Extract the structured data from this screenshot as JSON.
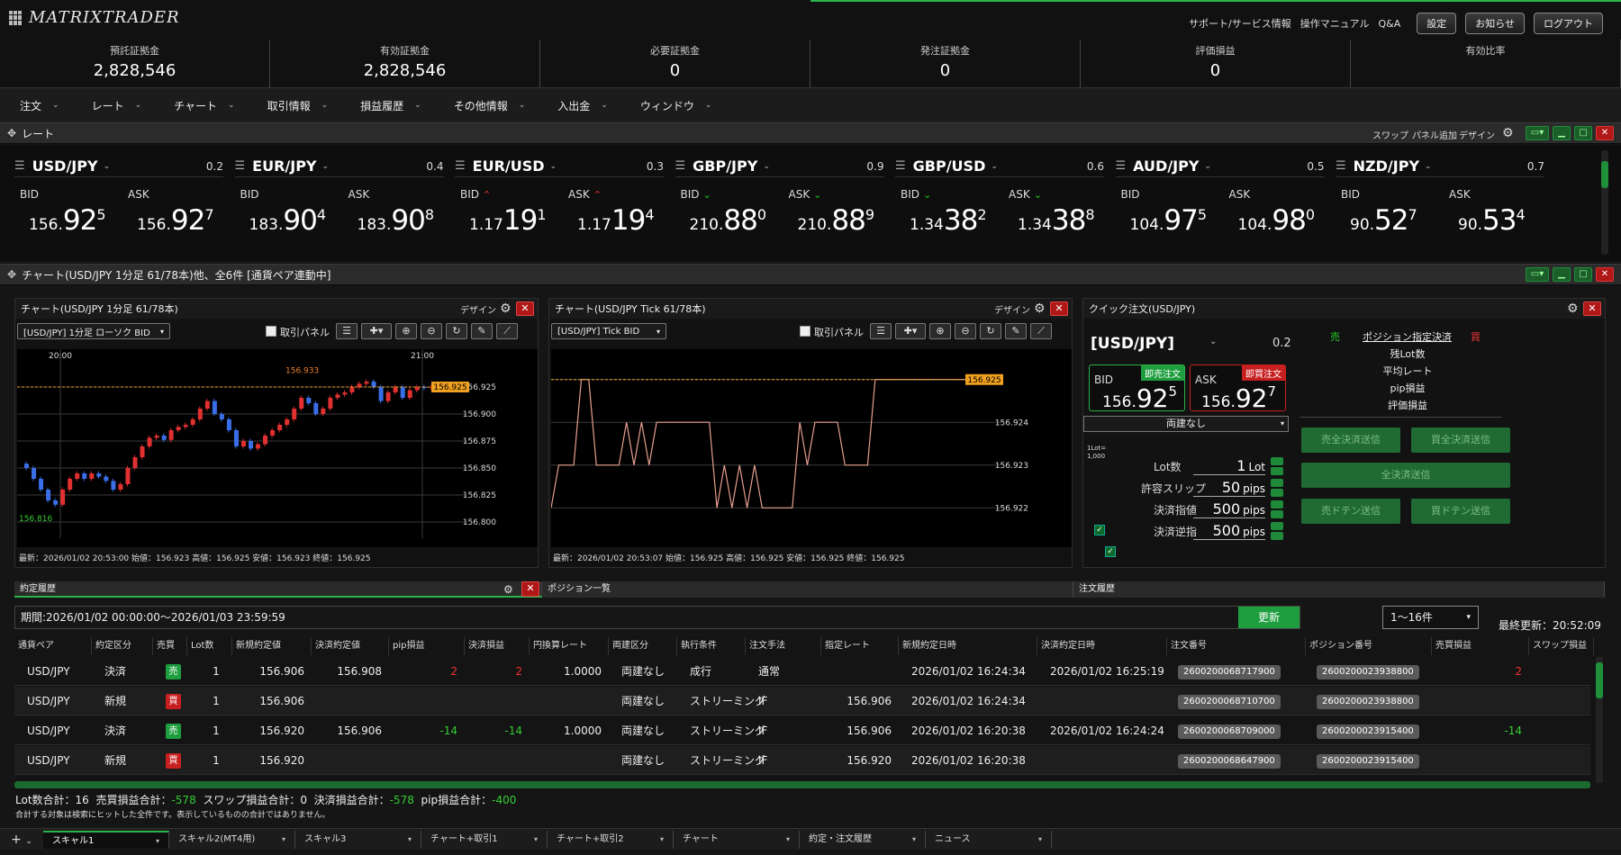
{
  "app": {
    "logo": "MATRIXTRADER"
  },
  "top_links": [
    "サポート/サービス情報",
    "操作マニュアル",
    "Q&A"
  ],
  "top_buttons": [
    "設定",
    "お知らせ",
    "ログアウト"
  ],
  "account": [
    {
      "label": "預託証拠金",
      "value": "2,828,546"
    },
    {
      "label": "有効証拠金",
      "value": "2,828,546"
    },
    {
      "label": "必要証拠金",
      "value": "0"
    },
    {
      "label": "発注証拠金",
      "value": "0"
    },
    {
      "label": "評価損益",
      "value": "0"
    },
    {
      "label": "有効比率",
      "value": ""
    }
  ],
  "menu": [
    "注文",
    "レート",
    "チャート",
    "取引情報",
    "損益履歴",
    "その他情報",
    "入出金",
    "ウィンドウ"
  ],
  "rate_panel": {
    "title": "レート",
    "actions": [
      "スワップ",
      "パネル追加",
      "デザイン"
    ]
  },
  "rates": [
    {
      "symbol": "USD/JPY",
      "spread": "0.2",
      "bid": {
        "s": "156.",
        "b": "92",
        "t": "5"
      },
      "ask": {
        "s": "156.",
        "b": "92",
        "t": "7"
      },
      "bid_dir": "",
      "ask_dir": ""
    },
    {
      "symbol": "EUR/JPY",
      "spread": "0.4",
      "bid": {
        "s": "183.",
        "b": "90",
        "t": "4"
      },
      "ask": {
        "s": "183.",
        "b": "90",
        "t": "8"
      },
      "bid_dir": "",
      "ask_dir": ""
    },
    {
      "symbol": "EUR/USD",
      "spread": "0.3",
      "bid": {
        "s": "1.17",
        "b": "19",
        "t": "1"
      },
      "ask": {
        "s": "1.17",
        "b": "19",
        "t": "4"
      },
      "bid_dir": "up",
      "ask_dir": "up"
    },
    {
      "symbol": "GBP/JPY",
      "spread": "0.9",
      "bid": {
        "s": "210.",
        "b": "88",
        "t": "0"
      },
      "ask": {
        "s": "210.",
        "b": "88",
        "t": "9"
      },
      "bid_dir": "down",
      "ask_dir": "down"
    },
    {
      "symbol": "GBP/USD",
      "spread": "0.6",
      "bid": {
        "s": "1.34",
        "b": "38",
        "t": "2"
      },
      "ask": {
        "s": "1.34",
        "b": "38",
        "t": "8"
      },
      "bid_dir": "down",
      "ask_dir": "down"
    },
    {
      "symbol": "AUD/JPY",
      "spread": "0.5",
      "bid": {
        "s": "104.",
        "b": "97",
        "t": "5"
      },
      "ask": {
        "s": "104.",
        "b": "98",
        "t": "0"
      },
      "bid_dir": "",
      "ask_dir": ""
    },
    {
      "symbol": "NZD/JPY",
      "spread": "0.7",
      "bid": {
        "s": "90.",
        "b": "52",
        "t": "7"
      },
      "ask": {
        "s": "90.",
        "b": "53",
        "t": "4"
      },
      "bid_dir": "",
      "ask_dir": ""
    }
  ],
  "labels": {
    "bid": "BID",
    "ask": "ASK",
    "design": "デザイン",
    "torihiki_panel": "取引パネル"
  },
  "chart_panel_title": "チャート(USD/JPY 1分足 61/78本)他、全6件 [通貨ペア連動中]",
  "chart1": {
    "title": "チャート(USD/JPY 1分足 61/78本)",
    "selector": "[USD/JPY] 1分足 ローソク BID",
    "time_labels": [
      "20:00",
      "21:00"
    ],
    "footer": "最新：2026/01/02 20:53:00  始値：156.923  高値：156.925  安値：156.923  終値：156.925"
  },
  "chart2": {
    "title": "チャート(USD/JPY Tick 61/78本)",
    "selector": "[USD/JPY] Tick BID",
    "footer": "最新：2026/01/02 20:53:07  始値：156.925  高値：156.925  安値：156.925  終値：156.925"
  },
  "chart_data": [
    {
      "type": "candlestick",
      "title": "チャート(USD/JPY 1分足 61/78本)",
      "x_ticks": [
        "20:00",
        "21:00"
      ],
      "y_ticks": [
        156.8,
        156.825,
        156.85,
        156.875,
        156.9,
        156.925
      ],
      "ylim": [
        156.795,
        156.945
      ],
      "current": 156.925,
      "high_label": 156.933,
      "low_label": 156.816,
      "closes": [
        156.85,
        156.84,
        156.83,
        156.82,
        156.816,
        156.83,
        156.84,
        156.845,
        156.84,
        156.845,
        156.842,
        156.838,
        156.83,
        156.835,
        156.85,
        156.86,
        156.87,
        156.878,
        156.88,
        156.876,
        156.885,
        156.888,
        156.89,
        156.895,
        156.905,
        156.912,
        156.9,
        156.895,
        156.885,
        156.87,
        156.875,
        156.868,
        156.872,
        156.88,
        156.885,
        156.89,
        156.895,
        156.905,
        156.915,
        156.91,
        156.9,
        156.905,
        156.915,
        156.918,
        156.92,
        156.925,
        156.928,
        156.93,
        156.925,
        156.912,
        156.92,
        156.925,
        156.915,
        156.922,
        156.925,
        156.924,
        156.925,
        156.923,
        156.925,
        156.925,
        156.925
      ],
      "grid": true
    },
    {
      "type": "line",
      "title": "チャート(USD/JPY Tick 61/78本)",
      "y_ticks": [
        156.922,
        156.923,
        156.924,
        156.925
      ],
      "ylim": [
        156.9215,
        156.9255
      ],
      "current": 156.925,
      "values": [
        156.922,
        156.923,
        156.923,
        156.923,
        156.925,
        156.925,
        156.923,
        156.923,
        156.923,
        156.923,
        156.924,
        156.923,
        156.924,
        156.923,
        156.924,
        156.924,
        156.924,
        156.924,
        156.924,
        156.924,
        156.924,
        156.924,
        156.922,
        156.923,
        156.922,
        156.923,
        156.922,
        156.923,
        156.922,
        156.922,
        156.922,
        156.922,
        156.922,
        156.924,
        156.923,
        156.924,
        156.924,
        156.924,
        156.924,
        156.923,
        156.923,
        156.923,
        156.923,
        156.925,
        156.925,
        156.925,
        156.925,
        156.925,
        156.925,
        156.925
      ],
      "grid": true
    }
  ],
  "quick": {
    "title": "クイック注文(USD/JPY)",
    "symbol": "[USD/JPY]",
    "spread": "0.2",
    "bid": {
      "s": "156.",
      "b": "92",
      "t": "5"
    },
    "ask": {
      "s": "156.",
      "b": "92",
      "t": "7"
    },
    "sell_badge": "即売注文",
    "buy_badge": "即買注文",
    "mode": "両建なし",
    "lot_unit_note": "1Lot=\n1,000",
    "rows": [
      {
        "label": "Lot数",
        "value": "1",
        "unit": "Lot",
        "checked": null
      },
      {
        "label": "許容スリップ",
        "value": "50",
        "unit": "pips",
        "checked": null
      },
      {
        "label": "決済指値",
        "value": "500",
        "unit": "pips",
        "checked": true
      },
      {
        "label": "決済逆指",
        "value": "500",
        "unit": "pips",
        "checked": true
      }
    ],
    "side_sell": "売",
    "side_buy": "買",
    "pos_link": "ポジション指定決済",
    "info": [
      "残Lot数",
      "平均レート",
      "pip損益",
      "評価損益"
    ],
    "buttons": [
      "売全決済送信",
      "買全決済送信",
      "全決済送信",
      "売ドテン送信",
      "買ドテン送信"
    ]
  },
  "bottom_tabs": [
    "約定履歴",
    "ポジション一覧",
    "注文履歴"
  ],
  "period": {
    "text": "期間:2026/01/02 00:00:00～2026/01/03 23:59:59",
    "update_btn": "更新",
    "range": "1～16件",
    "last_update": "最終更新：20:52:09"
  },
  "table": {
    "headers": [
      "通貨ペア",
      "約定区分",
      "売買",
      "Lot数",
      "新規約定値",
      "決済約定値",
      "pip損益",
      "決済損益",
      "円換算レート",
      "両建区分",
      "執行条件",
      "注文手法",
      "指定レート",
      "新規約定日時",
      "決済約定日時",
      "注文番号",
      "ポジション番号",
      "売買損益",
      "スワップ損益"
    ],
    "rows": [
      {
        "pair": "USD/JPY",
        "kind": "決済",
        "side": "売",
        "side_type": "sell",
        "lot": "1",
        "open": "156.906",
        "close": "156.908",
        "pip": "2",
        "pnl": "2",
        "rate": "1.0000",
        "hedge": "両建なし",
        "cond": "成行",
        "method": "通常",
        "spec": "",
        "open_time": "2026/01/02 16:24:34",
        "close_time": "2026/01/02 16:25:19",
        "order_no": "2600200068717900",
        "pos_no": "2600200023938800",
        "trade_pnl": "2",
        "swap": ""
      },
      {
        "pair": "USD/JPY",
        "kind": "新規",
        "side": "買",
        "side_type": "buy",
        "lot": "1",
        "open": "156.906",
        "close": "",
        "pip": "",
        "pnl": "",
        "rate": "",
        "hedge": "両建なし",
        "cond": "ストリーミング",
        "method": "IF",
        "spec": "156.906",
        "open_time": "2026/01/02 16:24:34",
        "close_time": "",
        "order_no": "2600200068710700",
        "pos_no": "2600200023938800",
        "trade_pnl": "",
        "swap": ""
      },
      {
        "pair": "USD/JPY",
        "kind": "決済",
        "side": "売",
        "side_type": "sell",
        "lot": "1",
        "open": "156.920",
        "close": "156.906",
        "pip": "-14",
        "pnl": "-14",
        "rate": "1.0000",
        "hedge": "両建なし",
        "cond": "ストリーミング",
        "method": "IF",
        "spec": "156.906",
        "open_time": "2026/01/02 16:20:38",
        "close_time": "2026/01/02 16:24:24",
        "order_no": "2600200068709000",
        "pos_no": "2600200023915400",
        "trade_pnl": "-14",
        "swap": ""
      },
      {
        "pair": "USD/JPY",
        "kind": "新規",
        "side": "買",
        "side_type": "buy",
        "lot": "1",
        "open": "156.920",
        "close": "",
        "pip": "",
        "pnl": "",
        "rate": "",
        "hedge": "両建なし",
        "cond": "ストリーミング",
        "method": "IF",
        "spec": "156.920",
        "open_time": "2026/01/02 16:20:38",
        "close_time": "",
        "order_no": "2600200068647900",
        "pos_no": "2600200023915400",
        "trade_pnl": "",
        "swap": ""
      }
    ]
  },
  "summary": {
    "lot_total_label": "Lot数合計：",
    "lot_total": "16",
    "trade_label": "売買損益合計：",
    "trade": "-578",
    "swap_label": "スワップ損益合計：",
    "swap": "0",
    "settle_label": "決済損益合計：",
    "settle": "-578",
    "pip_label": "pip損益合計：",
    "pip": "-400",
    "note": "合計する対象は検索にヒットした全件です。表示しているものの合計ではありません。"
  },
  "taskbar": [
    "スキャル1",
    "スキャル2(MT4用)",
    "スキャル3",
    "チャート+取引1",
    "チャート+取引2",
    "チャート",
    "約定・注文履歴",
    "ニュース"
  ],
  "colors": {
    "accent_green": "#2bb24c",
    "sell_green": "#1e9e3e",
    "buy_red": "#c82020",
    "candle_up": "#e03030",
    "candle_down": "#3a6ee8",
    "tick_line": "#e8a090",
    "current_line": "#f0a020"
  }
}
